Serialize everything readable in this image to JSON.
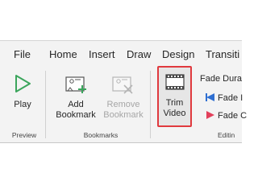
{
  "tabs": [
    {
      "label": "File"
    },
    {
      "label": "Home"
    },
    {
      "label": "Insert"
    },
    {
      "label": "Draw"
    },
    {
      "label": "Design"
    },
    {
      "label": "Transiti"
    }
  ],
  "preview": {
    "play_label": "Play",
    "group_label": "Preview"
  },
  "bookmarks": {
    "add_line1": "Add",
    "add_line2": "Bookmark",
    "remove_line1": "Remove",
    "remove_line2": "Bookmark",
    "group_label": "Bookmarks"
  },
  "editing": {
    "trim_line1": "Trim",
    "trim_line2": "Video",
    "fade_duration": "Fade Dura",
    "fade_in": "Fade I",
    "fade_out": "Fade C",
    "group_label": "Editin"
  },
  "colors": {
    "play_green": "#3ba55c",
    "accent_red": "#e0393e",
    "tab_accent": "#c43e1c",
    "fade_blue": "#2f6fd1",
    "fade_red": "#e2405b"
  },
  "icons": [
    "play-icon",
    "add-bookmark-icon",
    "remove-bookmark-icon",
    "trim-video-icon",
    "fade-in-icon",
    "fade-out-icon"
  ]
}
